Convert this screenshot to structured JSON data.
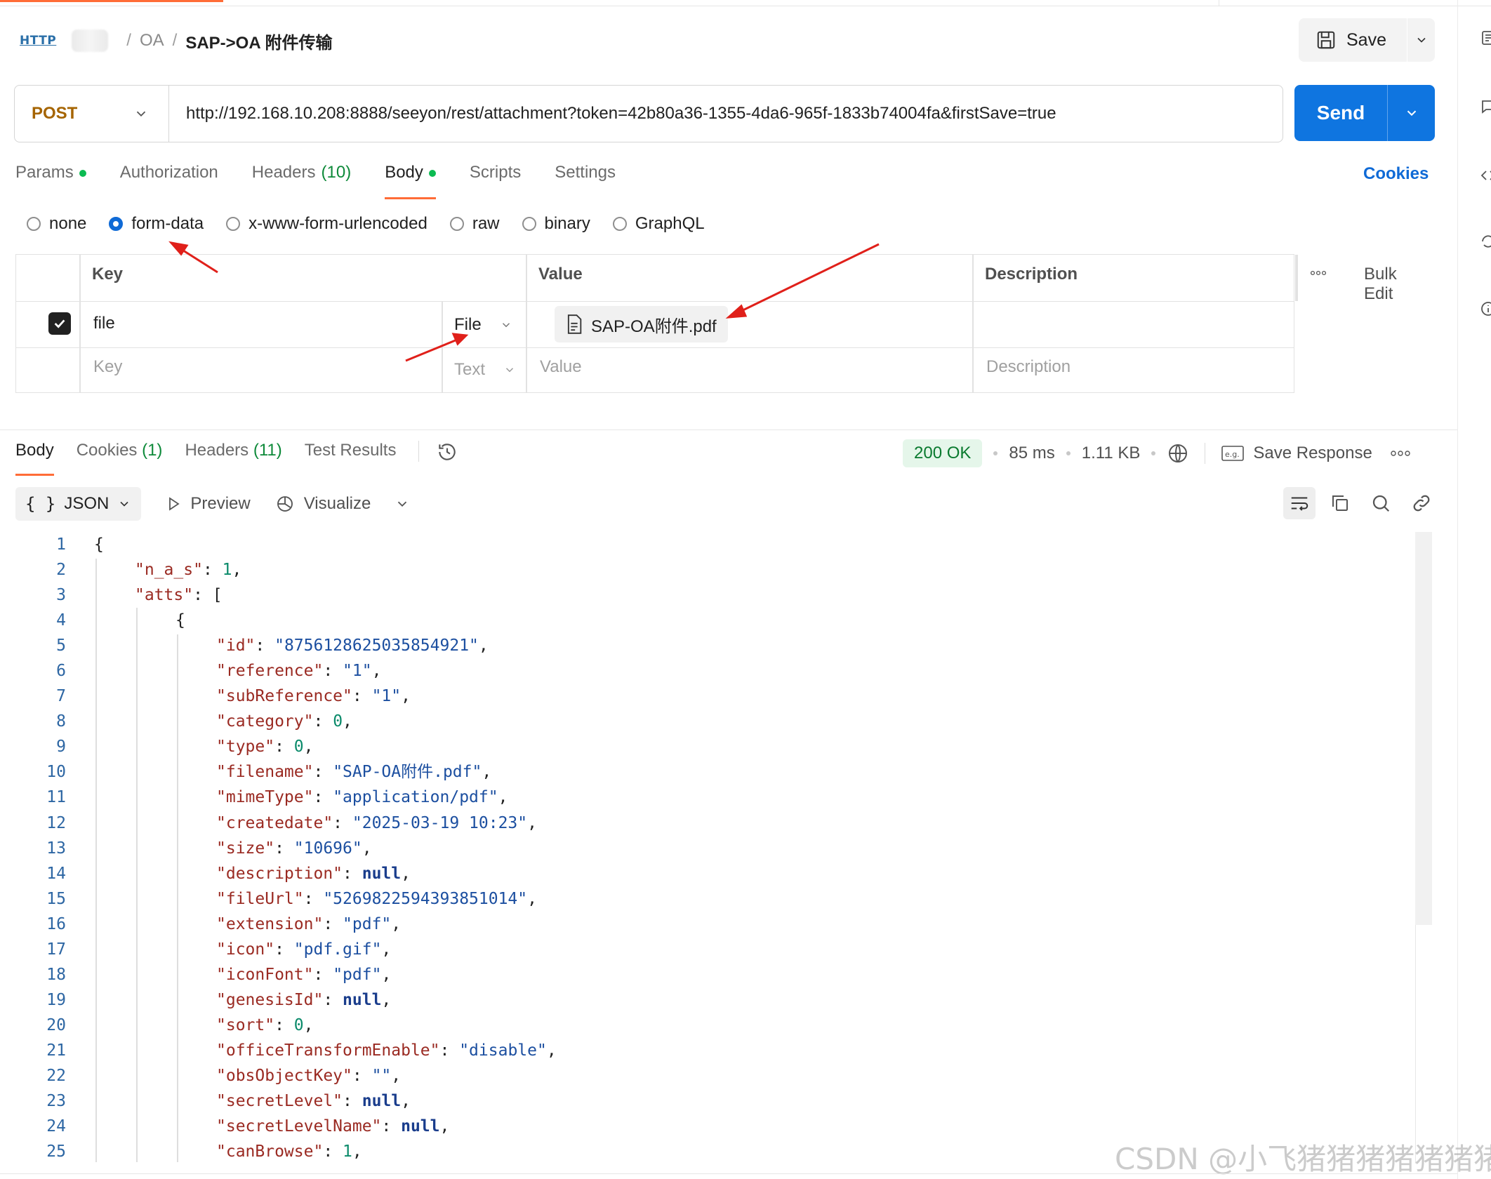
{
  "header": {
    "http_badge": "HTTP",
    "breadcrumb": [
      "OA",
      "SAP->OA 附件传输"
    ],
    "save_label": "Save"
  },
  "request": {
    "method": "POST",
    "url": "http://192.168.10.208:8888/seeyon/rest/attachment?token=42b80a36-1355-4da6-965f-1833b74004fa&firstSave=true",
    "send_label": "Send"
  },
  "tabs": [
    {
      "label": "Params",
      "count": "",
      "dot": true
    },
    {
      "label": "Authorization",
      "count": "",
      "dot": false
    },
    {
      "label": "Headers",
      "count": "(10)",
      "dot": false
    },
    {
      "label": "Body",
      "count": "",
      "dot": true,
      "active": true
    },
    {
      "label": "Scripts",
      "count": "",
      "dot": false
    },
    {
      "label": "Settings",
      "count": "",
      "dot": false
    }
  ],
  "cookies_link": "Cookies",
  "body_types": [
    "none",
    "form-data",
    "x-www-form-urlencoded",
    "raw",
    "binary",
    "GraphQL"
  ],
  "body_type_selected": "form-data",
  "form_table": {
    "headers": {
      "key": "Key",
      "value": "Value",
      "description": "Description",
      "bulk_edit": "Bulk Edit"
    },
    "rows": [
      {
        "checked": true,
        "key": "file",
        "type": "File",
        "value": "SAP-OA附件.pdf",
        "description": ""
      }
    ],
    "placeholder": {
      "key": "Key",
      "type": "Text",
      "value": "Value",
      "description": "Description"
    }
  },
  "response": {
    "tabs": [
      {
        "label": "Body",
        "count": "",
        "active": true
      },
      {
        "label": "Cookies",
        "count": "(1)"
      },
      {
        "label": "Headers",
        "count": "(11)"
      },
      {
        "label": "Test Results",
        "count": ""
      }
    ],
    "status": "200 OK",
    "time": "85 ms",
    "size": "1.11 KB",
    "save_response": "Save Response",
    "format": "JSON",
    "preview": "Preview",
    "visualize": "Visualize"
  },
  "code_lines": [
    {
      "n": "1",
      "indent": 0,
      "parts": [
        [
          "p",
          "{"
        ]
      ]
    },
    {
      "n": "2",
      "indent": 1,
      "parts": [
        [
          "k",
          "\"n_a_s\""
        ],
        [
          "p",
          ": "
        ],
        [
          "n",
          "1"
        ],
        [
          "p",
          ","
        ]
      ]
    },
    {
      "n": "3",
      "indent": 1,
      "parts": [
        [
          "k",
          "\"atts\""
        ],
        [
          "p",
          ": ["
        ]
      ]
    },
    {
      "n": "4",
      "indent": 2,
      "parts": [
        [
          "p",
          "{"
        ]
      ]
    },
    {
      "n": "5",
      "indent": 3,
      "parts": [
        [
          "k",
          "\"id\""
        ],
        [
          "p",
          ": "
        ],
        [
          "s",
          "\"8756128625035854921\""
        ],
        [
          "p",
          ","
        ]
      ]
    },
    {
      "n": "6",
      "indent": 3,
      "parts": [
        [
          "k",
          "\"reference\""
        ],
        [
          "p",
          ": "
        ],
        [
          "s",
          "\"1\""
        ],
        [
          "p",
          ","
        ]
      ]
    },
    {
      "n": "7",
      "indent": 3,
      "parts": [
        [
          "k",
          "\"subReference\""
        ],
        [
          "p",
          ": "
        ],
        [
          "s",
          "\"1\""
        ],
        [
          "p",
          ","
        ]
      ]
    },
    {
      "n": "8",
      "indent": 3,
      "parts": [
        [
          "k",
          "\"category\""
        ],
        [
          "p",
          ": "
        ],
        [
          "n",
          "0"
        ],
        [
          "p",
          ","
        ]
      ]
    },
    {
      "n": "9",
      "indent": 3,
      "parts": [
        [
          "k",
          "\"type\""
        ],
        [
          "p",
          ": "
        ],
        [
          "n",
          "0"
        ],
        [
          "p",
          ","
        ]
      ]
    },
    {
      "n": "10",
      "indent": 3,
      "parts": [
        [
          "k",
          "\"filename\""
        ],
        [
          "p",
          ": "
        ],
        [
          "s",
          "\"SAP-OA附件.pdf\""
        ],
        [
          "p",
          ","
        ]
      ]
    },
    {
      "n": "11",
      "indent": 3,
      "parts": [
        [
          "k",
          "\"mimeType\""
        ],
        [
          "p",
          ": "
        ],
        [
          "s",
          "\"application/pdf\""
        ],
        [
          "p",
          ","
        ]
      ]
    },
    {
      "n": "12",
      "indent": 3,
      "parts": [
        [
          "k",
          "\"createdate\""
        ],
        [
          "p",
          ": "
        ],
        [
          "s",
          "\"2025-03-19 10:23\""
        ],
        [
          "p",
          ","
        ]
      ]
    },
    {
      "n": "13",
      "indent": 3,
      "parts": [
        [
          "k",
          "\"size\""
        ],
        [
          "p",
          ": "
        ],
        [
          "s",
          "\"10696\""
        ],
        [
          "p",
          ","
        ]
      ]
    },
    {
      "n": "14",
      "indent": 3,
      "parts": [
        [
          "k",
          "\"description\""
        ],
        [
          "p",
          ": "
        ],
        [
          "kw",
          "null"
        ],
        [
          "p",
          ","
        ]
      ]
    },
    {
      "n": "15",
      "indent": 3,
      "parts": [
        [
          "k",
          "\"fileUrl\""
        ],
        [
          "p",
          ": "
        ],
        [
          "s",
          "\"5269822594393851014\""
        ],
        [
          "p",
          ","
        ]
      ]
    },
    {
      "n": "16",
      "indent": 3,
      "parts": [
        [
          "k",
          "\"extension\""
        ],
        [
          "p",
          ": "
        ],
        [
          "s",
          "\"pdf\""
        ],
        [
          "p",
          ","
        ]
      ]
    },
    {
      "n": "17",
      "indent": 3,
      "parts": [
        [
          "k",
          "\"icon\""
        ],
        [
          "p",
          ": "
        ],
        [
          "s",
          "\"pdf.gif\""
        ],
        [
          "p",
          ","
        ]
      ]
    },
    {
      "n": "18",
      "indent": 3,
      "parts": [
        [
          "k",
          "\"iconFont\""
        ],
        [
          "p",
          ": "
        ],
        [
          "s",
          "\"pdf\""
        ],
        [
          "p",
          ","
        ]
      ]
    },
    {
      "n": "19",
      "indent": 3,
      "parts": [
        [
          "k",
          "\"genesisId\""
        ],
        [
          "p",
          ": "
        ],
        [
          "kw",
          "null"
        ],
        [
          "p",
          ","
        ]
      ]
    },
    {
      "n": "20",
      "indent": 3,
      "parts": [
        [
          "k",
          "\"sort\""
        ],
        [
          "p",
          ": "
        ],
        [
          "n",
          "0"
        ],
        [
          "p",
          ","
        ]
      ]
    },
    {
      "n": "21",
      "indent": 3,
      "parts": [
        [
          "k",
          "\"officeTransformEnable\""
        ],
        [
          "p",
          ": "
        ],
        [
          "s",
          "\"disable\""
        ],
        [
          "p",
          ","
        ]
      ]
    },
    {
      "n": "22",
      "indent": 3,
      "parts": [
        [
          "k",
          "\"obsObjectKey\""
        ],
        [
          "p",
          ": "
        ],
        [
          "s",
          "\"\""
        ],
        [
          "p",
          ","
        ]
      ]
    },
    {
      "n": "23",
      "indent": 3,
      "parts": [
        [
          "k",
          "\"secretLevel\""
        ],
        [
          "p",
          ": "
        ],
        [
          "kw",
          "null"
        ],
        [
          "p",
          ","
        ]
      ]
    },
    {
      "n": "24",
      "indent": 3,
      "parts": [
        [
          "k",
          "\"secretLevelName\""
        ],
        [
          "p",
          ": "
        ],
        [
          "kw",
          "null"
        ],
        [
          "p",
          ","
        ]
      ]
    },
    {
      "n": "25",
      "indent": 3,
      "parts": [
        [
          "k",
          "\"canBrowse\""
        ],
        [
          "p",
          ": "
        ],
        [
          "n",
          "1"
        ],
        [
          "p",
          ","
        ]
      ]
    }
  ],
  "watermark": "CSDN @小飞猪猪猪猪猪猪猪",
  "colors": {
    "accent": "#ff6c37",
    "send": "#0f75e0",
    "method": "#a56400",
    "ok": "#0a7a2f",
    "annotation_arrow": "#e0201a"
  }
}
